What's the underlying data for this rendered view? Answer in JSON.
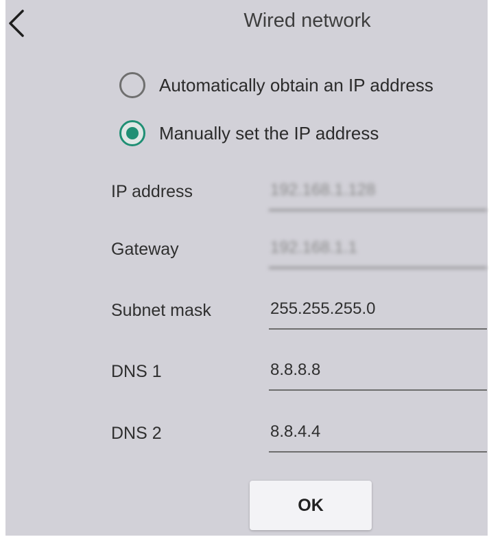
{
  "header": {
    "title": "Wired network",
    "back_icon": "chevron-left-icon"
  },
  "ip_mode": {
    "options": [
      {
        "label": "Automatically obtain an IP address",
        "checked": false
      },
      {
        "label": "Manually set the IP address",
        "checked": true
      }
    ],
    "accent_color": "#1f8f74"
  },
  "fields": {
    "ip_address": {
      "label": "IP address",
      "value": "192.168.1.128",
      "blurred": true
    },
    "gateway": {
      "label": "Gateway",
      "value": "192.168.1.1",
      "blurred": true
    },
    "subnet_mask": {
      "label": "Subnet mask",
      "value": "255.255.255.0"
    },
    "dns1": {
      "label": "DNS 1",
      "value": "8.8.8.8"
    },
    "dns2": {
      "label": "DNS 2",
      "value": "8.8.4.4"
    }
  },
  "ok_button": {
    "label": "OK"
  }
}
